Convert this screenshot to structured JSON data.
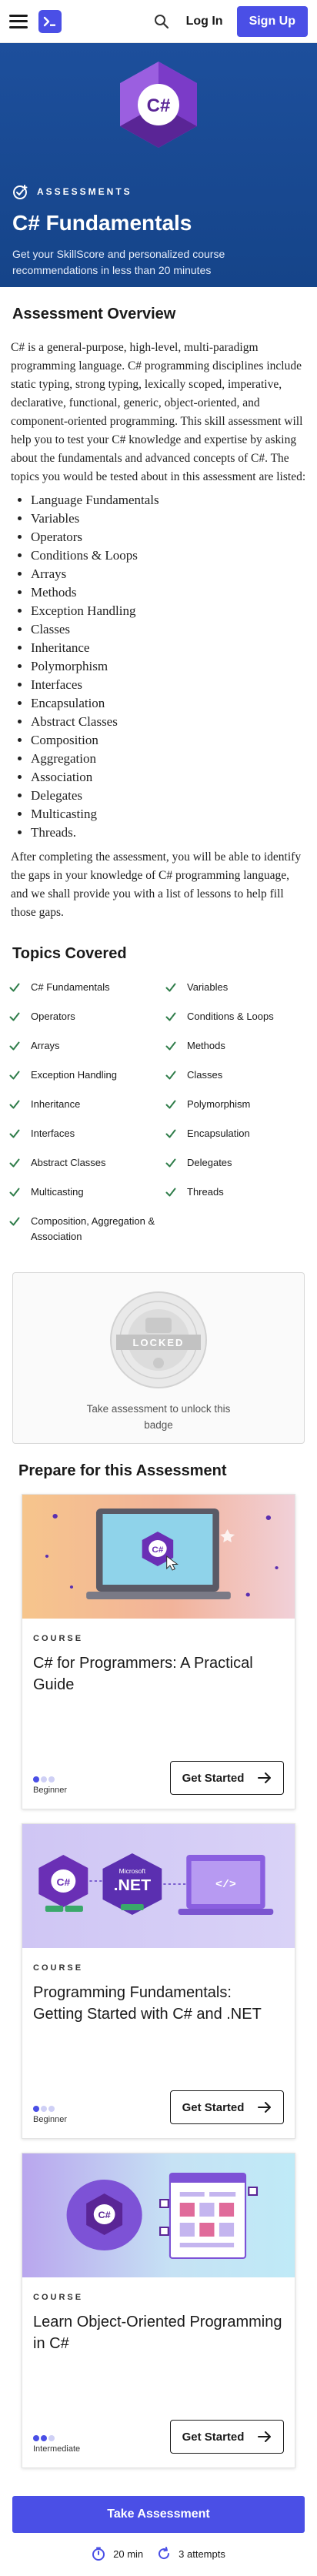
{
  "header": {
    "login_label": "Log In",
    "signup_label": "Sign Up",
    "icons": [
      "menu-icon",
      "brand-logo-icon",
      "search-icon"
    ]
  },
  "hero": {
    "eyebrow": "ASSESSMENTS",
    "title": "C# Fundamentals",
    "subtitle": "Get your SkillScore and personalized course recommendations in less than 20 minutes",
    "badge_text": "C#",
    "colors": {
      "background": "#1d4f9c",
      "badge": "#6a2fb5"
    }
  },
  "overview": {
    "title": "Assessment Overview",
    "intro": "C# is a general-purpose, high-level, multi-paradigm programming language. C# programming disciplines include static typing, strong typing, lexically scoped, imperative, declarative, functional, generic, object-oriented, and component-oriented programming. This skill assessment will help you to test your C# knowledge and expertise by asking about the fundamentals and advanced concepts of C#. The topics you would be tested about in this assessment are listed:",
    "list": [
      "Language Fundamentals",
      "Variables",
      "Operators",
      "Conditions & Loops",
      "Arrays",
      "Methods",
      "Exception Handling",
      "Classes",
      "Inheritance",
      "Polymorphism",
      "Interfaces",
      "Encapsulation",
      "Abstract Classes",
      "Composition",
      "Aggregation",
      "Association",
      "Delegates",
      "Multicasting",
      "Threads."
    ],
    "outro": "After completing the assessment, you will be able to identify the gaps in your knowledge of C# programming language, and we shall provide you with a list of lessons to help fill those gaps."
  },
  "topics": {
    "title": "Topics Covered",
    "items": [
      "C# Fundamentals",
      "Variables",
      "Operators",
      "Conditions & Loops",
      "Arrays",
      "Methods",
      "Exception Handling",
      "Classes",
      "Inheritance",
      "Polymorphism",
      "Interfaces",
      "Encapsulation",
      "Abstract Classes",
      "Delegates",
      "Multicasting",
      "Threads",
      "Composition, Aggregation & Association"
    ]
  },
  "badge": {
    "locked_label": "LOCKED",
    "caption": "Take assessment to unlock this badge"
  },
  "prepare": {
    "title": "Prepare for this Assessment",
    "courses": [
      {
        "kicker": "COURSE",
        "title": "C# for Programmers: A Practical Guide",
        "level": "Beginner",
        "level_value": 1,
        "button": "Get Started",
        "image_badge": "C#"
      },
      {
        "kicker": "COURSE",
        "title": "Programming Fundamentals: Getting Started with C# and .NET",
        "level": "Beginner",
        "level_value": 1,
        "button": "Get Started",
        "image_badge": "C#",
        "image_logo_top": "Microsoft",
        "image_logo_main": ".NET",
        "image_code": "</>"
      },
      {
        "kicker": "COURSE",
        "title": "Learn Object-Oriented Programming in C#",
        "level": "Intermediate",
        "level_value": 2,
        "button": "Get Started",
        "image_badge": "C#"
      }
    ]
  },
  "cta": {
    "button": "Take Assessment",
    "duration": "20 min",
    "attempts": "3 attempts"
  }
}
